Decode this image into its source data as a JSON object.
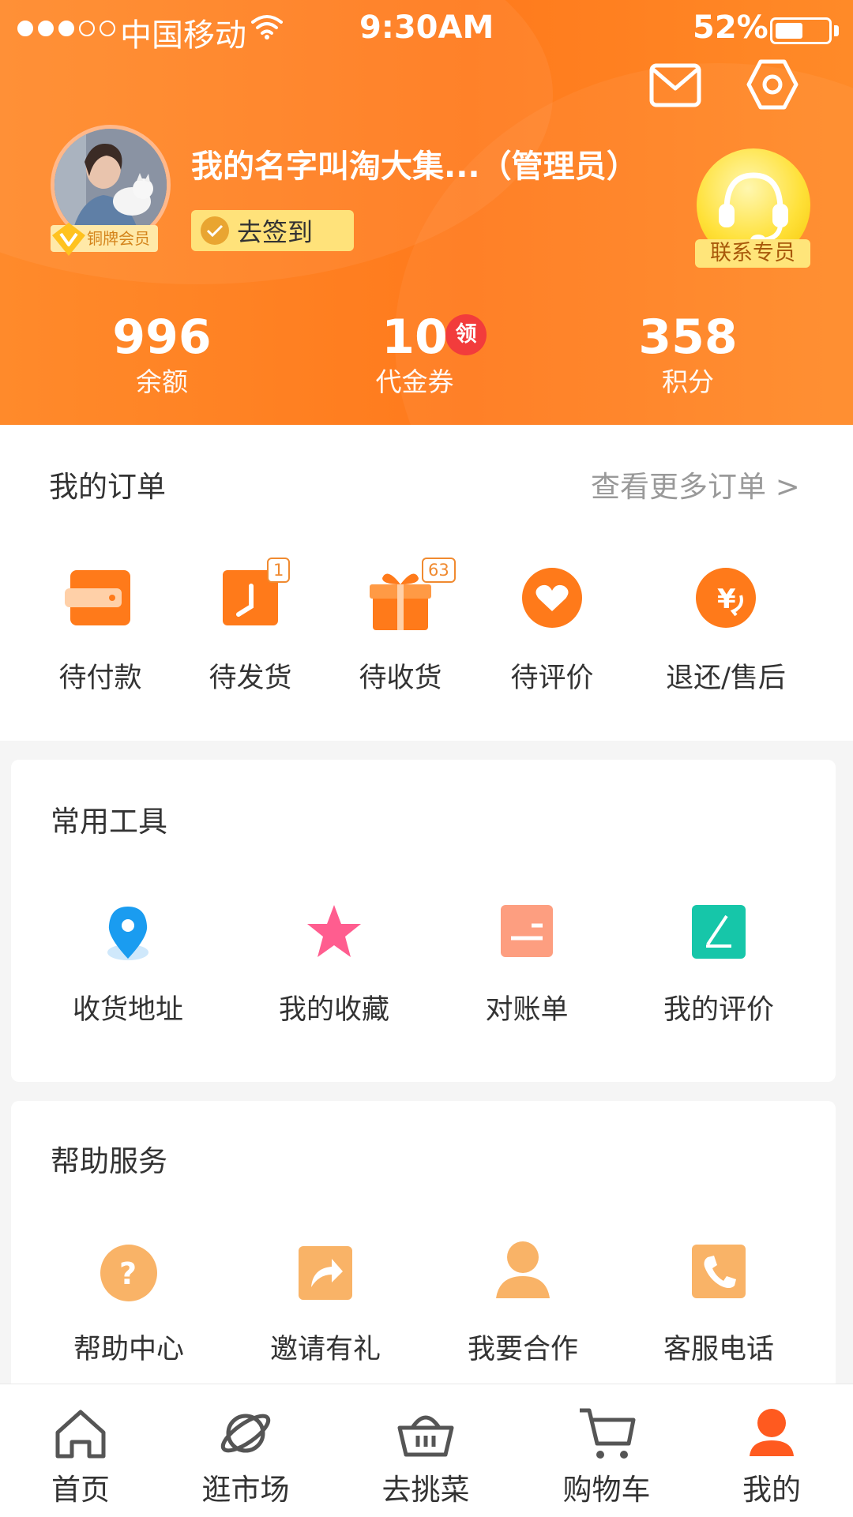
{
  "status_bar": {
    "carrier": "中国移动",
    "time": "9:30AM",
    "battery": "52%",
    "battery_level": 0.52
  },
  "profile": {
    "username": "我的名字叫淘大集...（管理员）",
    "membership": "铜牌会员",
    "signin_label": "去签到",
    "contact_label": "联系专员"
  },
  "stats": [
    {
      "value": "996",
      "label": "余额"
    },
    {
      "value": "10",
      "label": "代金券",
      "badge": "领"
    },
    {
      "value": "358",
      "label": "积分"
    }
  ],
  "orders": {
    "title": "我的订单",
    "more": "查看更多订单 >",
    "items": [
      {
        "label": "待付款",
        "icon": "wallet-icon"
      },
      {
        "label": "待发货",
        "icon": "clock-icon",
        "badge": "1"
      },
      {
        "label": "待收货",
        "icon": "gift-icon",
        "badge": "63"
      },
      {
        "label": "待评价",
        "icon": "heart-icon"
      },
      {
        "label": "退还/售后",
        "icon": "yen-refund-icon"
      }
    ]
  },
  "tools": {
    "title": "常用工具",
    "items": [
      {
        "label": "收货地址",
        "icon": "location-pin-icon"
      },
      {
        "label": "我的收藏",
        "icon": "star-icon"
      },
      {
        "label": "对账单",
        "icon": "statement-icon"
      },
      {
        "label": "我的评价",
        "icon": "pen-icon"
      }
    ]
  },
  "help": {
    "title": "帮助服务",
    "items": [
      {
        "label": "帮助中心",
        "icon": "question-icon"
      },
      {
        "label": "邀请有礼",
        "icon": "share-icon"
      },
      {
        "label": "我要合作",
        "icon": "person-icon"
      },
      {
        "label": "客服电话",
        "icon": "phone-icon"
      }
    ]
  },
  "tabbar": [
    {
      "label": "首页",
      "icon": "home-icon"
    },
    {
      "label": "逛市场",
      "icon": "planet-icon"
    },
    {
      "label": "去挑菜",
      "icon": "basket-icon"
    },
    {
      "label": "购物车",
      "icon": "cart-icon"
    },
    {
      "label": "我的",
      "icon": "user-icon",
      "active": true
    }
  ],
  "colors": {
    "brand": "#ff7e22",
    "accent_red": "#f23c3c"
  }
}
